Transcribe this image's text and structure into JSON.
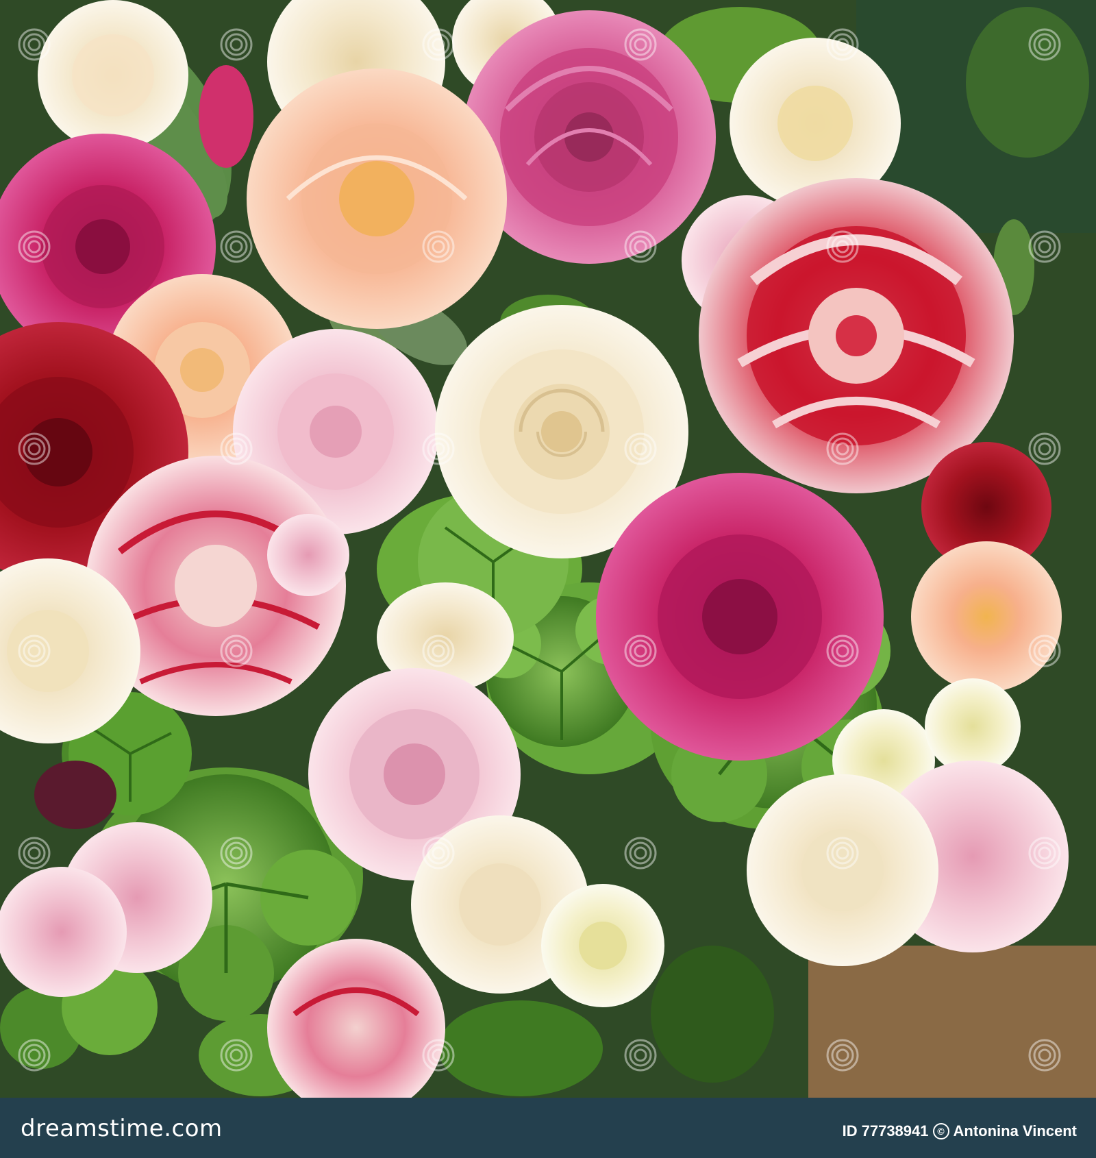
{
  "image": {
    "subject": "Bouquet of roses with green geranium leaves",
    "colors": {
      "foliage": "#5f9a32",
      "deep_red": "#9c0f1c",
      "magenta": "#c41e62",
      "peach": "#f4b895",
      "cream": "#f3ead2",
      "pale_pink": "#f2c2cf",
      "footer_bg": "#24404e"
    }
  },
  "watermark": {
    "site_text": "dreamstime.com",
    "id_label": "ID",
    "id_value": "77738941",
    "copyright_icon": "c-circle-icon",
    "author": "Antonina Vincent"
  }
}
